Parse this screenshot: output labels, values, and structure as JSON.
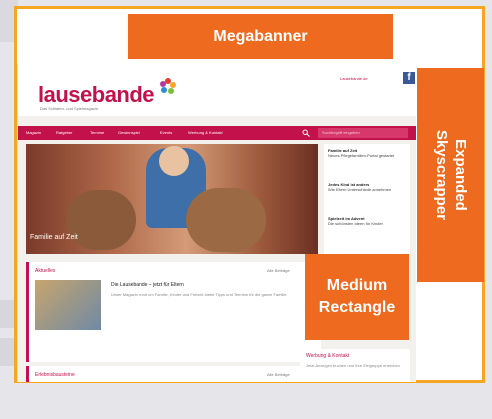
{
  "ads": {
    "megabanner": "Megabanner",
    "medium_rectangle_line1": "Medium",
    "medium_rectangle_line2": "Rectangle",
    "skyscraper_line1": "Expanded",
    "skyscraper_line2": "Skyscrapper"
  },
  "site": {
    "logo": "lausebande",
    "tagline": "Das Schlafen- und Spielmagazin",
    "login_link": "Lausebande.de",
    "nav": [
      "Magazin",
      "Ratgeber",
      "Termine",
      "Gewinnspiel",
      "Events",
      "Werbung & Kontakt"
    ],
    "search_placeholder": "Suchbegriff eingeben",
    "hero_caption": "Familie auf Zeit",
    "side_items": [
      {
        "title": "Familie auf Zeit",
        "text": "Neues Pflegefamilien-Portal gestartet"
      },
      {
        "title": "Jedes Kind ist anders",
        "text": "Wie Eltern Unterschiede annehmen"
      },
      {
        "title": "Spielzeit im Advent",
        "text": "Die schönsten Ideen für Kinder"
      }
    ],
    "aktuelles": {
      "title": "Aktuelles",
      "more": "Alle Beiträge",
      "headline": "Die Lausebande – jetzt für Eltern",
      "text": "Unser Magazin rund um Familie, Kinder und Freizeit bietet Tipps und Termine für die ganze Familie."
    },
    "bottom": {
      "title": "Erlebnisbausteine",
      "more": "Alle Beiträge"
    },
    "right_box": {
      "title": "Werbung & Kontakt",
      "text": "Jetzt Anzeigen buchen und Ihre Zielgruppe erreichen"
    }
  },
  "colors": {
    "accent": "#c3124b",
    "ad": "#ee6a1e",
    "frame": "#f5a623"
  }
}
